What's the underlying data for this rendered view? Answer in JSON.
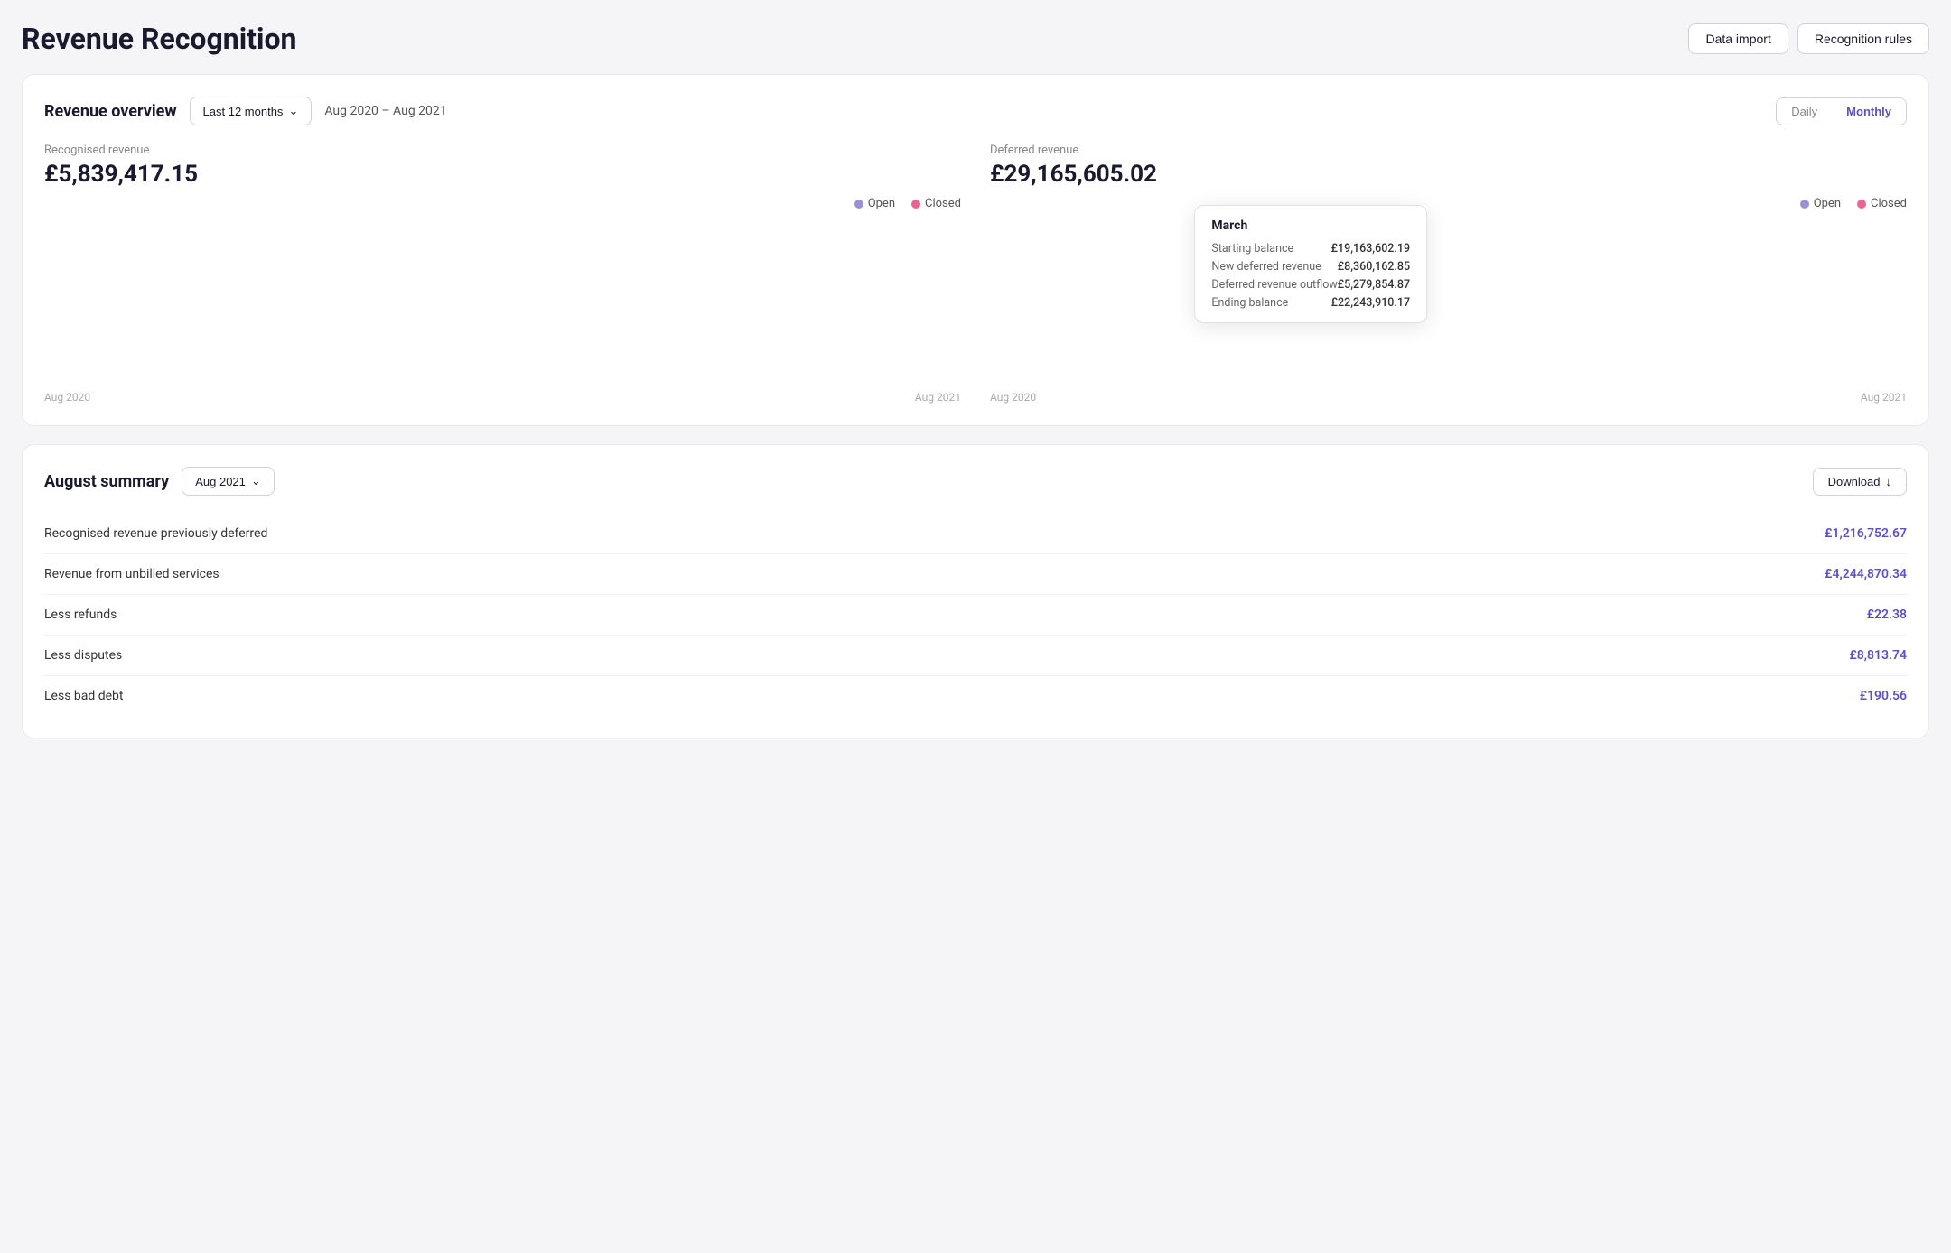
{
  "header": {
    "title": "Revenue Recognition",
    "buttons": {
      "data_import": "Data import",
      "recognition_rules": "Recognition rules"
    }
  },
  "revenue_overview": {
    "title": "Revenue overview",
    "period_dropdown": "Last 12 months",
    "date_range": "Aug 2020 – Aug 2021",
    "toggle": {
      "daily": "Daily",
      "monthly": "Monthly",
      "active": "Monthly"
    },
    "recognised": {
      "label": "Recognised revenue",
      "value": "£5,839,417.15",
      "legend_open": "Open",
      "legend_closed": "Closed"
    },
    "deferred": {
      "label": "Deferred revenue",
      "value": "£29,165,605.02",
      "legend_open": "Open",
      "legend_closed": "Closed"
    },
    "chart_x_start": "Aug 2020",
    "chart_x_end": "Aug 2021",
    "tooltip": {
      "title": "March",
      "rows": [
        {
          "label": "Starting balance",
          "value": "£19,163,602.19"
        },
        {
          "label": "New deferred revenue",
          "value": "£8,360,162.85"
        },
        {
          "label": "Deferred revenue outflow",
          "value": "£5,279,854.87"
        },
        {
          "label": "Ending balance",
          "value": "£22,243,910.17"
        }
      ]
    }
  },
  "august_summary": {
    "title": "August summary",
    "period_dropdown": "Aug 2021",
    "download_label": "Download",
    "rows": [
      {
        "label": "Recognised revenue previously deferred",
        "amount": "£1,216,752.67"
      },
      {
        "label": "Revenue from unbilled services",
        "amount": "£4,244,870.34"
      },
      {
        "label": "Less refunds",
        "amount": "£22.38"
      },
      {
        "label": "Less disputes",
        "amount": "£8,813.74"
      },
      {
        "label": "Less bad debt",
        "amount": "£190.56"
      }
    ]
  }
}
